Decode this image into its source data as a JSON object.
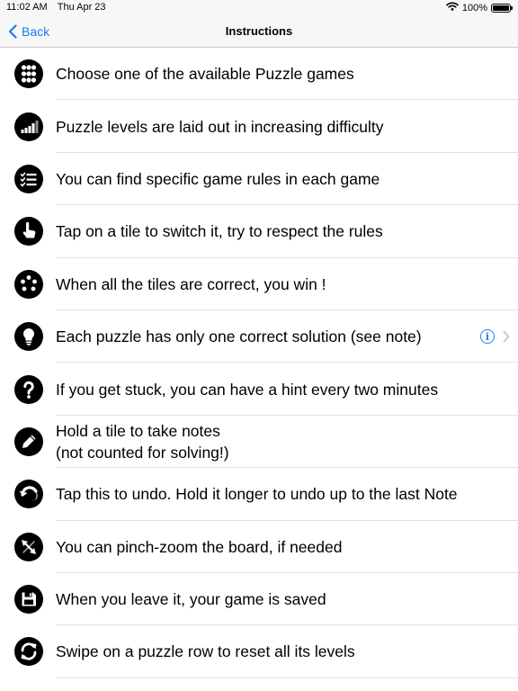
{
  "status_bar": {
    "time": "11:02 AM",
    "date": "Thu Apr 23",
    "battery": "100%",
    "battery_level": 1.0
  },
  "nav": {
    "back_label": "Back",
    "title": "Instructions"
  },
  "items": [
    {
      "icon": "grid-dots-icon",
      "text": "Choose one of the available Puzzle games"
    },
    {
      "icon": "signal-bars-icon",
      "text": "Puzzle levels are laid out in increasing difficulty"
    },
    {
      "icon": "checklist-icon",
      "text": "You can find specific game rules in each game"
    },
    {
      "icon": "hand-pointer-icon",
      "text": "Tap on a tile to switch it, try to respect the rules"
    },
    {
      "icon": "dots-pattern-icon",
      "text": "When all the tiles are correct, you win !"
    },
    {
      "icon": "lightbulb-icon",
      "text": "Each puzzle has only one correct solution (see note)",
      "has_info": true
    },
    {
      "icon": "question-mark-icon",
      "text": "If you get stuck, you can have a hint every two minutes"
    },
    {
      "icon": "pencil-icon",
      "text": "Hold a tile to take notes\n(not counted for solving!)"
    },
    {
      "icon": "undo-icon",
      "text": "Tap this to undo. Hold it longer to undo up to the last Note"
    },
    {
      "icon": "pinch-zoom-icon",
      "text": "You can pinch-zoom the board, if needed"
    },
    {
      "icon": "floppy-save-icon",
      "text": "When you leave it, your game is saved"
    },
    {
      "icon": "reset-arrows-icon",
      "text": "Swipe on a puzzle row to reset all its levels"
    }
  ]
}
